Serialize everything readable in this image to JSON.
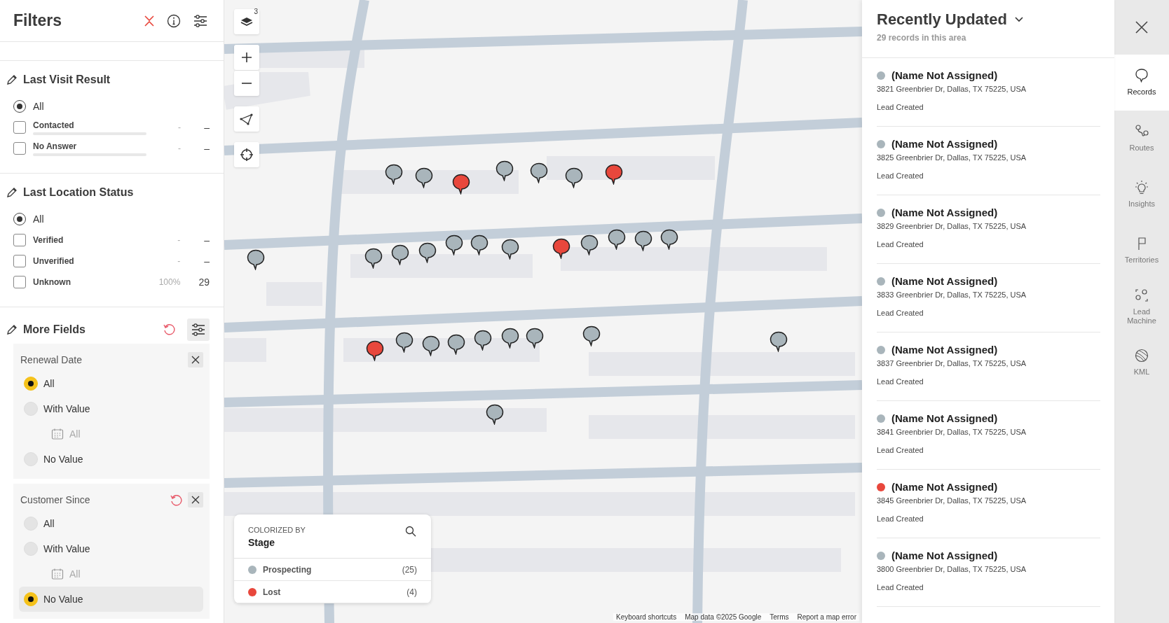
{
  "filters": {
    "title": "Filters",
    "sections": [
      {
        "title": "Last Visit Result",
        "options": [
          {
            "kind": "radio",
            "label": "All",
            "selected": true
          },
          {
            "kind": "checkbox_bar",
            "label": "Contacted",
            "checked": false,
            "percent": "-",
            "count": "–"
          },
          {
            "kind": "checkbox_bar",
            "label": "No Answer",
            "checked": false,
            "percent": "-",
            "count": "–"
          }
        ]
      },
      {
        "title": "Last Location Status",
        "options": [
          {
            "kind": "radio",
            "label": "All",
            "selected": true
          },
          {
            "kind": "checkbox",
            "label": "Verified",
            "checked": false,
            "percent": "-",
            "count": "–"
          },
          {
            "kind": "checkbox",
            "label": "Unverified",
            "checked": false,
            "percent": "-",
            "count": "–"
          },
          {
            "kind": "checkbox",
            "label": "Unknown",
            "checked": false,
            "percent": "100%",
            "count": "29"
          }
        ]
      }
    ],
    "more_fields": {
      "title": "More Fields",
      "fields": [
        {
          "title": "Renewal Date",
          "reset": false,
          "options": [
            {
              "label": "All",
              "selected": true,
              "hovered": false
            },
            {
              "label": "With Value",
              "selected": false,
              "hovered": false,
              "date_label": "All"
            },
            {
              "label": "No Value",
              "selected": false,
              "hovered": false
            }
          ]
        },
        {
          "title": "Customer Since",
          "reset": true,
          "options": [
            {
              "label": "All",
              "selected": false,
              "hovered": false
            },
            {
              "label": "With Value",
              "selected": false,
              "hovered": false,
              "date_label": "All"
            },
            {
              "label": "No Value",
              "selected": true,
              "hovered": true
            }
          ]
        }
      ]
    }
  },
  "map": {
    "layers_badge": "3",
    "pins": [
      {
        "color": "#a9b5bb"
      },
      {
        "color": "#a9b5bb"
      },
      {
        "color": "#e8473c"
      },
      {
        "color": "#a9b5bb"
      },
      {
        "color": "#a9b5bb"
      },
      {
        "color": "#a9b5bb"
      },
      {
        "color": "#e8473c"
      },
      {
        "color": "#a9b5bb"
      },
      {
        "color": "#a9b5bb"
      },
      {
        "color": "#a9b5bb"
      },
      {
        "color": "#a9b5bb"
      },
      {
        "color": "#a9b5bb"
      },
      {
        "color": "#a9b5bb"
      },
      {
        "color": "#a9b5bb"
      },
      {
        "color": "#e8473c"
      },
      {
        "color": "#a9b5bb"
      },
      {
        "color": "#a9b5bb"
      },
      {
        "color": "#a9b5bb"
      },
      {
        "color": "#a9b5bb"
      },
      {
        "color": "#e8473c"
      },
      {
        "color": "#a9b5bb"
      },
      {
        "color": "#a9b5bb"
      },
      {
        "color": "#a9b5bb"
      },
      {
        "color": "#a9b5bb"
      },
      {
        "color": "#a9b5bb"
      },
      {
        "color": "#a9b5bb"
      },
      {
        "color": "#a9b5bb"
      },
      {
        "color": "#a9b5bb"
      },
      {
        "color": "#a9b5bb"
      }
    ],
    "legend": {
      "caption": "COLORIZED BY",
      "title": "Stage",
      "items": [
        {
          "label": "Prospecting",
          "count": "(25)",
          "color": "#a9b5bb"
        },
        {
          "label": "Lost",
          "count": "(4)",
          "color": "#e8473c"
        }
      ]
    },
    "attribution": [
      "Keyboard shortcuts",
      "Map data ©2025 Google",
      "Terms",
      "Report a map error"
    ]
  },
  "records": {
    "title": "Recently Updated",
    "subtitle": "29 records in this area",
    "items": [
      {
        "name": "(Name Not Assigned)",
        "address": "3821 Greenbrier Dr, Dallas, TX 75225, USA",
        "status": "Lead Created",
        "color": "#a9b5bb"
      },
      {
        "name": "(Name Not Assigned)",
        "address": "3825 Greenbrier Dr, Dallas, TX 75225, USA",
        "status": "Lead Created",
        "color": "#a9b5bb"
      },
      {
        "name": "(Name Not Assigned)",
        "address": "3829 Greenbrier Dr, Dallas, TX 75225, USA",
        "status": "Lead Created",
        "color": "#a9b5bb"
      },
      {
        "name": "(Name Not Assigned)",
        "address": "3833 Greenbrier Dr, Dallas, TX 75225, USA",
        "status": "Lead Created",
        "color": "#a9b5bb"
      },
      {
        "name": "(Name Not Assigned)",
        "address": "3837 Greenbrier Dr, Dallas, TX 75225, USA",
        "status": "Lead Created",
        "color": "#a9b5bb"
      },
      {
        "name": "(Name Not Assigned)",
        "address": "3841 Greenbrier Dr, Dallas, TX 75225, USA",
        "status": "Lead Created",
        "color": "#a9b5bb"
      },
      {
        "name": "(Name Not Assigned)",
        "address": "3845 Greenbrier Dr, Dallas, TX 75225, USA",
        "status": "Lead Created",
        "color": "#e8473c"
      },
      {
        "name": "(Name Not Assigned)",
        "address": "3800 Greenbrier Dr, Dallas, TX 75225, USA",
        "status": "Lead Created",
        "color": "#a9b5bb"
      }
    ]
  },
  "sidebar": {
    "tabs": [
      {
        "kind": "records",
        "label": "Records",
        "selected": true
      },
      {
        "kind": "routes",
        "label": "Routes",
        "selected": false
      },
      {
        "kind": "insights",
        "label": "Insights",
        "selected": false
      },
      {
        "kind": "territories",
        "label": "Territories",
        "selected": false
      },
      {
        "kind": "lead",
        "label": "Lead Machine",
        "selected": false
      },
      {
        "kind": "kml",
        "label": "KML",
        "selected": false
      }
    ]
  }
}
